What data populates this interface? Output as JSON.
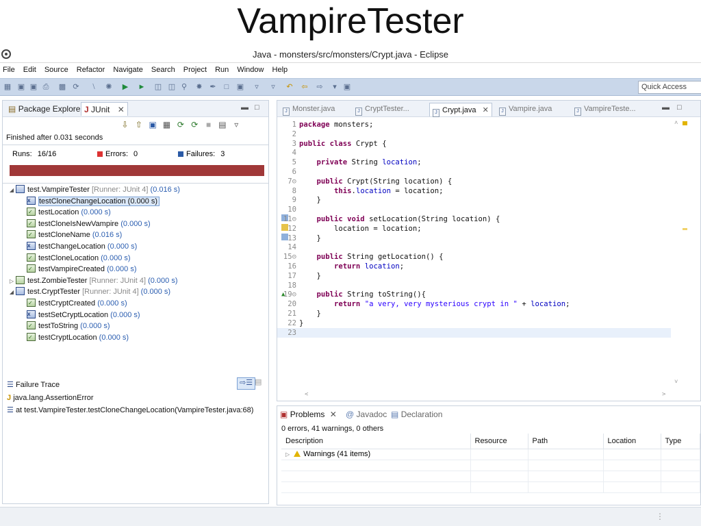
{
  "slide_title": "VampireTester",
  "window": {
    "title": "Java - monsters/src/monsters/Crypt.java - Eclipse"
  },
  "menu": [
    "File",
    "Edit",
    "Source",
    "Refactor",
    "Navigate",
    "Search",
    "Project",
    "Run",
    "Window",
    "Help"
  ],
  "toolbar": {
    "quick_access_placeholder": "Quick Access"
  },
  "left_tabs": {
    "package_explorer": "Package Explorer",
    "junit": "JUnit"
  },
  "junit": {
    "finished": "Finished after 0.031 seconds",
    "runs_label": "Runs:",
    "runs_value": "16/16",
    "errors_label": "Errors:",
    "errors_value": "0",
    "failures_label": "Failures:",
    "failures_value": "3",
    "progress_state": "failed",
    "tree": [
      {
        "label": "test.VampireTester",
        "runner": "[Runner: JUnit 4]",
        "time": "(0.016 s)",
        "level": 0,
        "kind": "suite",
        "status": "fail",
        "twisty": "◢"
      },
      {
        "label": "testCloneChangeLocation",
        "time": "(0.000 s)",
        "level": 1,
        "kind": "test",
        "status": "fail",
        "selected": true
      },
      {
        "label": "testLocation",
        "time": "(0.000 s)",
        "level": 1,
        "kind": "test",
        "status": "pass"
      },
      {
        "label": "testCloneIsNewVampire",
        "time": "(0.000 s)",
        "level": 1,
        "kind": "test",
        "status": "pass"
      },
      {
        "label": "testCloneName",
        "time": "(0.016 s)",
        "level": 1,
        "kind": "test",
        "status": "pass"
      },
      {
        "label": "testChangeLocation",
        "time": "(0.000 s)",
        "level": 1,
        "kind": "test",
        "status": "fail"
      },
      {
        "label": "testCloneLocation",
        "time": "(0.000 s)",
        "level": 1,
        "kind": "test",
        "status": "pass"
      },
      {
        "label": "testVampireCreated",
        "time": "(0.000 s)",
        "level": 1,
        "kind": "test",
        "status": "pass"
      },
      {
        "label": "test.ZombieTester",
        "runner": "[Runner: JUnit 4]",
        "time": "(0.000 s)",
        "level": 0,
        "kind": "suite",
        "status": "pass",
        "twisty": "▷"
      },
      {
        "label": "test.CryptTester",
        "runner": "[Runner: JUnit 4]",
        "time": "(0.000 s)",
        "level": 0,
        "kind": "suite",
        "status": "fail",
        "twisty": "◢"
      },
      {
        "label": "testCryptCreated",
        "time": "(0.000 s)",
        "level": 1,
        "kind": "test",
        "status": "pass"
      },
      {
        "label": "testSetCryptLocation",
        "time": "(0.000 s)",
        "level": 1,
        "kind": "test",
        "status": "fail"
      },
      {
        "label": "testToString",
        "time": "(0.000 s)",
        "level": 1,
        "kind": "test",
        "status": "pass"
      },
      {
        "label": "testCryptLocation",
        "time": "(0.000 s)",
        "level": 1,
        "kind": "test",
        "status": "pass"
      }
    ],
    "failure_trace_label": "Failure Trace",
    "trace": [
      "java.lang.AssertionError",
      "at test.VampireTester.testCloneChangeLocation(VampireTester.java:68)"
    ]
  },
  "editor": {
    "tabs": [
      {
        "label": "Monster.java",
        "active": false
      },
      {
        "label": "CryptTester...",
        "active": false
      },
      {
        "label": "Crypt.java",
        "active": true
      },
      {
        "label": "Vampire.java",
        "active": false
      },
      {
        "label": "VampireTeste...",
        "active": false
      }
    ],
    "current_line": 23,
    "lines": [
      {
        "n": "1",
        "html": "<span class=\"kw\">package</span> monsters;"
      },
      {
        "n": "2",
        "html": ""
      },
      {
        "n": "3",
        "html": "<span class=\"kw\">public class</span> Crypt {"
      },
      {
        "n": "4",
        "html": ""
      },
      {
        "n": "5",
        "html": "    <span class=\"kw\">private</span> String <span class=\"fld\">location</span>;"
      },
      {
        "n": "6",
        "html": ""
      },
      {
        "n": "7⊝",
        "html": "    <span class=\"kw\">public</span> Crypt(String location) {"
      },
      {
        "n": "8",
        "html": "        <span class=\"kw\">this</span>.<span class=\"fld\">location</span> = location;"
      },
      {
        "n": "9",
        "html": "    }"
      },
      {
        "n": "10",
        "html": ""
      },
      {
        "n": "11⊝",
        "html": "    <span class=\"kw\">public void</span> setLocation(String location) {"
      },
      {
        "n": "12",
        "html": "        location = location;"
      },
      {
        "n": "13",
        "html": "    }"
      },
      {
        "n": "14",
        "html": ""
      },
      {
        "n": "15⊝",
        "html": "    <span class=\"kw\">public</span> String getLocation() {"
      },
      {
        "n": "16",
        "html": "        <span class=\"kw\">return</span> <span class=\"fld\">location</span>;"
      },
      {
        "n": "17",
        "html": "    }"
      },
      {
        "n": "18",
        "html": ""
      },
      {
        "n": "19⊝",
        "html": "    <span class=\"kw\">public</span> String toString(){"
      },
      {
        "n": "20",
        "html": "        <span class=\"kw\">return</span> <span class=\"str\">\"a very, very mysterious crypt in \"</span> + <span class=\"fld\">location</span>;"
      },
      {
        "n": "21",
        "html": "    }"
      },
      {
        "n": "22",
        "html": "}"
      },
      {
        "n": "23",
        "html": ""
      }
    ]
  },
  "problems": {
    "tabs": [
      "Problems",
      "Javadoc",
      "Declaration"
    ],
    "summary": "0 errors, 41 warnings, 0 others",
    "columns": [
      "Description",
      "Resource",
      "Path",
      "Location",
      "Type"
    ],
    "rows": [
      {
        "description": "Warnings (41 items)",
        "resource": "",
        "path": "",
        "location": "",
        "type": ""
      }
    ]
  },
  "colors": {
    "failure_bar": "#a03838",
    "toolbar_bg": "#c9d7ea",
    "keyword": "#7f0055",
    "field": "#0000c0",
    "string": "#2a00ff",
    "time_text": "#2a5db0"
  }
}
